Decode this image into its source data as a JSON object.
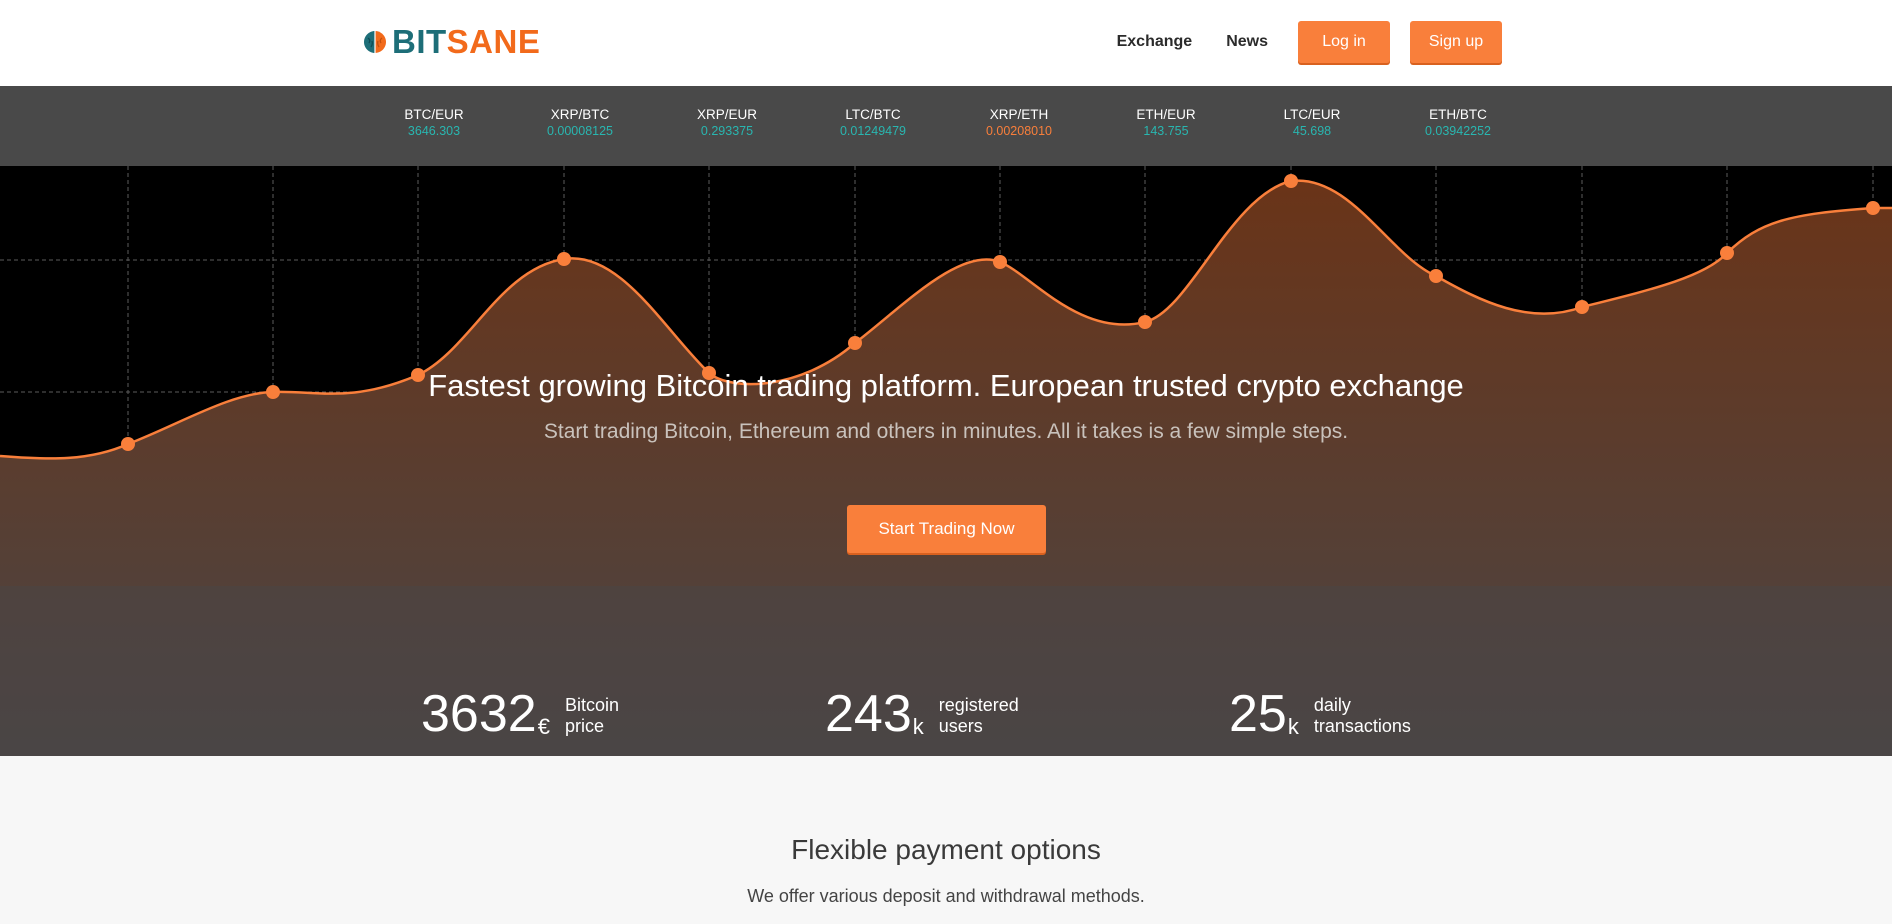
{
  "header": {
    "logo": {
      "part1": "BIT",
      "part2": "SANE"
    },
    "nav": [
      {
        "label": "Exchange"
      },
      {
        "label": "News"
      }
    ],
    "login_label": "Log in",
    "signup_label": "Sign up"
  },
  "ticker": [
    {
      "pair": "BTC/EUR",
      "value": "3646.303",
      "trend": "up"
    },
    {
      "pair": "XRP/BTC",
      "value": "0.00008125",
      "trend": "up"
    },
    {
      "pair": "XRP/EUR",
      "value": "0.293375",
      "trend": "up"
    },
    {
      "pair": "LTC/BTC",
      "value": "0.01249479",
      "trend": "up"
    },
    {
      "pair": "XRP/ETH",
      "value": "0.00208010",
      "trend": "down"
    },
    {
      "pair": "ETH/EUR",
      "value": "143.755",
      "trend": "up"
    },
    {
      "pair": "LTC/EUR",
      "value": "45.698",
      "trend": "up"
    },
    {
      "pair": "ETH/BTC",
      "value": "0.03942252",
      "trend": "up"
    }
  ],
  "hero": {
    "title": "Fastest growing Bitcoin trading platform. European trusted crypto exchange",
    "subtitle": "Start trading Bitcoin, Ethereum and others in minutes. All it takes is a few simple steps.",
    "cta_label": "Start Trading Now",
    "stats": [
      {
        "number": "3632",
        "unit": "€",
        "label_line1": "Bitcoin",
        "label_line2": "price"
      },
      {
        "number": "243",
        "unit": "k",
        "label_line1": "registered",
        "label_line2": "users"
      },
      {
        "number": "25",
        "unit": "k",
        "label_line1": "daily",
        "label_line2": "transactions"
      }
    ]
  },
  "payments": {
    "title": "Flexible payment options",
    "subtitle": "We offer various deposit and withdrawal methods."
  },
  "colors": {
    "accent": "#f97f3b",
    "teal": "#29b6b0",
    "ticker_bg": "#494949",
    "logo_teal": "#1d6e78",
    "logo_orange": "#f26a1b"
  }
}
